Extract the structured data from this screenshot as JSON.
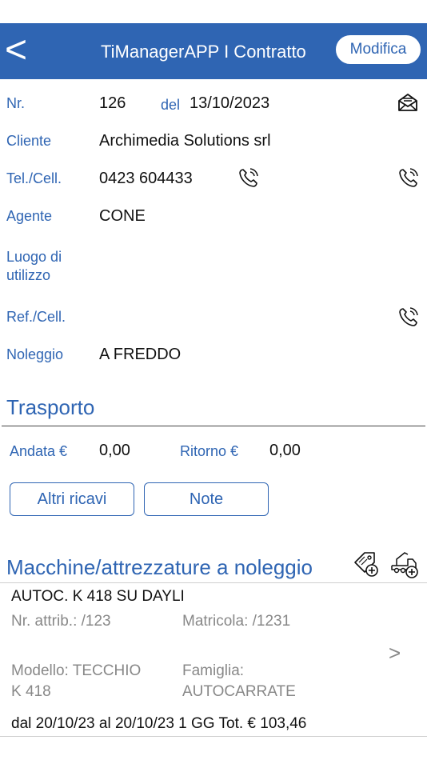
{
  "header": {
    "back_label": "<",
    "title": "TiManagerAPP I Contratto",
    "edit_label": "Modifica"
  },
  "contract": {
    "nr_label": "Nr.",
    "nr_value": "126",
    "del_label": "del",
    "date": "13/10/2023",
    "cliente_label": "Cliente",
    "cliente_value": "Archimedia Solutions srl",
    "tel_label": "Tel./Cell.",
    "tel_value": "0423 604433",
    "agente_label": "Agente",
    "agente_value": "CONE",
    "luogo_label_1": "Luogo di",
    "luogo_label_2": "utilizzo",
    "ref_label": "Ref./Cell.",
    "noleggio_label": "Noleggio",
    "noleggio_value": "A FREDDO"
  },
  "trasporto": {
    "title": "Trasporto",
    "andata_label": "Andata €",
    "andata_value": "0,00",
    "ritorno_label": "Ritorno €",
    "ritorno_value": "0,00",
    "altri_ricavi_label": "Altri ricavi",
    "note_label": "Note"
  },
  "machines": {
    "title": "Macchine/attrezzature a noleggio",
    "items": [
      {
        "name": "AUTOC. K 418 SU DAYLI",
        "nr_attrib": "Nr. attrib.: /123",
        "matricola": "Matricola: /1231",
        "modello_1": "Modello: TECCHIO",
        "modello_2": "K 418",
        "famiglia_1": "Famiglia:",
        "famiglia_2": "AUTOCARRATE",
        "period": "dal 20/10/23 al 20/10/23 1 GG Tot. € 103,46",
        "chevron": ">"
      }
    ]
  },
  "icons": {
    "mail": "envelope-open-icon",
    "phone": "phone-ringing-icon",
    "add_tag": "add-attribution-icon",
    "add_truck": "add-truck-icon"
  },
  "colors": {
    "accent": "#2f65b3",
    "text": "#111111",
    "muted": "#888888"
  }
}
